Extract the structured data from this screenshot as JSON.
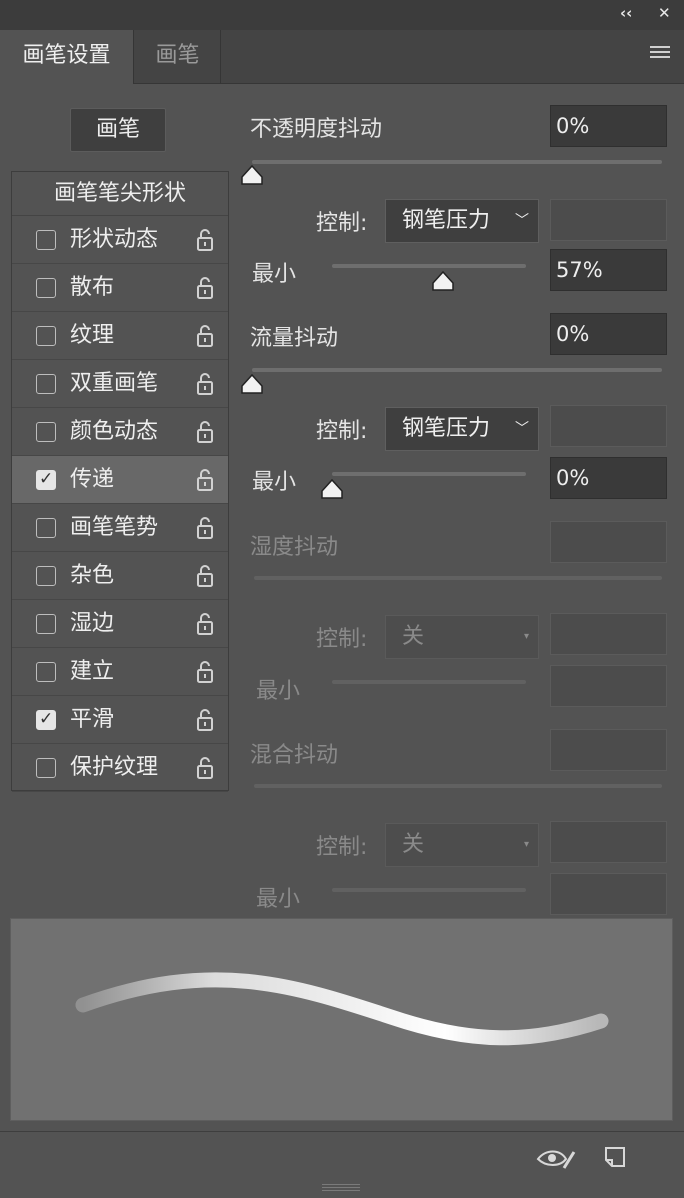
{
  "window": {
    "collapse_label": "‹‹",
    "close_label": "✕"
  },
  "tabs": [
    {
      "label": "画笔设置",
      "active": true
    },
    {
      "label": "画笔",
      "active": false
    }
  ],
  "brush_button": {
    "label": "画笔"
  },
  "sidebar": {
    "header": "画笔笔尖形状",
    "items": [
      {
        "label": "形状动态",
        "checked": false
      },
      {
        "label": "散布",
        "checked": false
      },
      {
        "label": "纹理",
        "checked": false
      },
      {
        "label": "双重画笔",
        "checked": false
      },
      {
        "label": "颜色动态",
        "checked": false
      },
      {
        "label": "传递",
        "checked": true,
        "selected": true
      },
      {
        "label": "画笔笔势",
        "checked": false
      },
      {
        "label": "杂色",
        "checked": false
      },
      {
        "label": "湿边",
        "checked": false
      },
      {
        "label": "建立",
        "checked": false
      },
      {
        "label": "平滑",
        "checked": true
      },
      {
        "label": "保护纹理",
        "checked": false
      }
    ]
  },
  "opacity_jitter": {
    "label": "不透明度抖动",
    "value": "0%",
    "slider_fraction": 0,
    "control_label": "控制:",
    "control_value": "钢笔压力",
    "min_label": "最小",
    "min_value": "57%",
    "min_slider_fraction": 0.57
  },
  "flow_jitter": {
    "label": "流量抖动",
    "value": "0%",
    "slider_fraction": 0,
    "control_label": "控制:",
    "control_value": "钢笔压力",
    "min_label": "最小",
    "min_value": "0%",
    "min_slider_fraction": 0
  },
  "wetness_jitter": {
    "label": "湿度抖动",
    "value": "",
    "enabled": false,
    "control_label": "控制:",
    "control_value": "关",
    "min_label": "最小",
    "min_value": ""
  },
  "mix_jitter": {
    "label": "混合抖动",
    "value": "",
    "enabled": false,
    "control_label": "控制:",
    "control_value": "关",
    "min_label": "最小",
    "min_value": ""
  },
  "colors": {
    "panel_bg": "#535353",
    "field_bg": "#3a3a3a",
    "preview_bg": "#717171"
  }
}
